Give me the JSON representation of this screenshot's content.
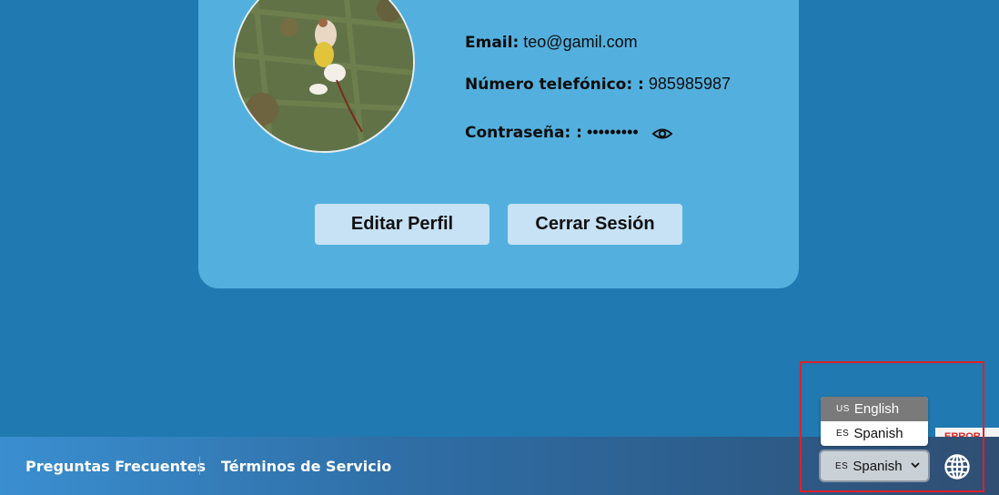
{
  "profile": {
    "email_label": "Email:",
    "email_value": "teo@gamil.com",
    "phone_label": "Número telefónico: :",
    "phone_value": "985985987",
    "password_label": "Contraseña: :",
    "password_value": "•••••••••",
    "reveal_icon": "eye-icon",
    "avatar_alt": "dog-photo"
  },
  "actions": {
    "edit_label": "Editar Perfil",
    "logout_label": "Cerrar Sesión"
  },
  "footer": {
    "faq_label": "Preguntas Frecuentes",
    "terms_label": "Términos de Servicio",
    "error_badge": "ERROR"
  },
  "language": {
    "selected_code": "ES",
    "selected_label": "Spanish",
    "options": [
      {
        "code": "US",
        "label": "English",
        "hovered": true
      },
      {
        "code": "ES",
        "label": "Spanish",
        "hovered": false
      }
    ],
    "icon": "globe-icon"
  },
  "colors": {
    "page_bg": "#2079b0",
    "card_bg": "#53b0de",
    "button_bg": "#c6e2f4",
    "highlight": "#e0202a"
  }
}
